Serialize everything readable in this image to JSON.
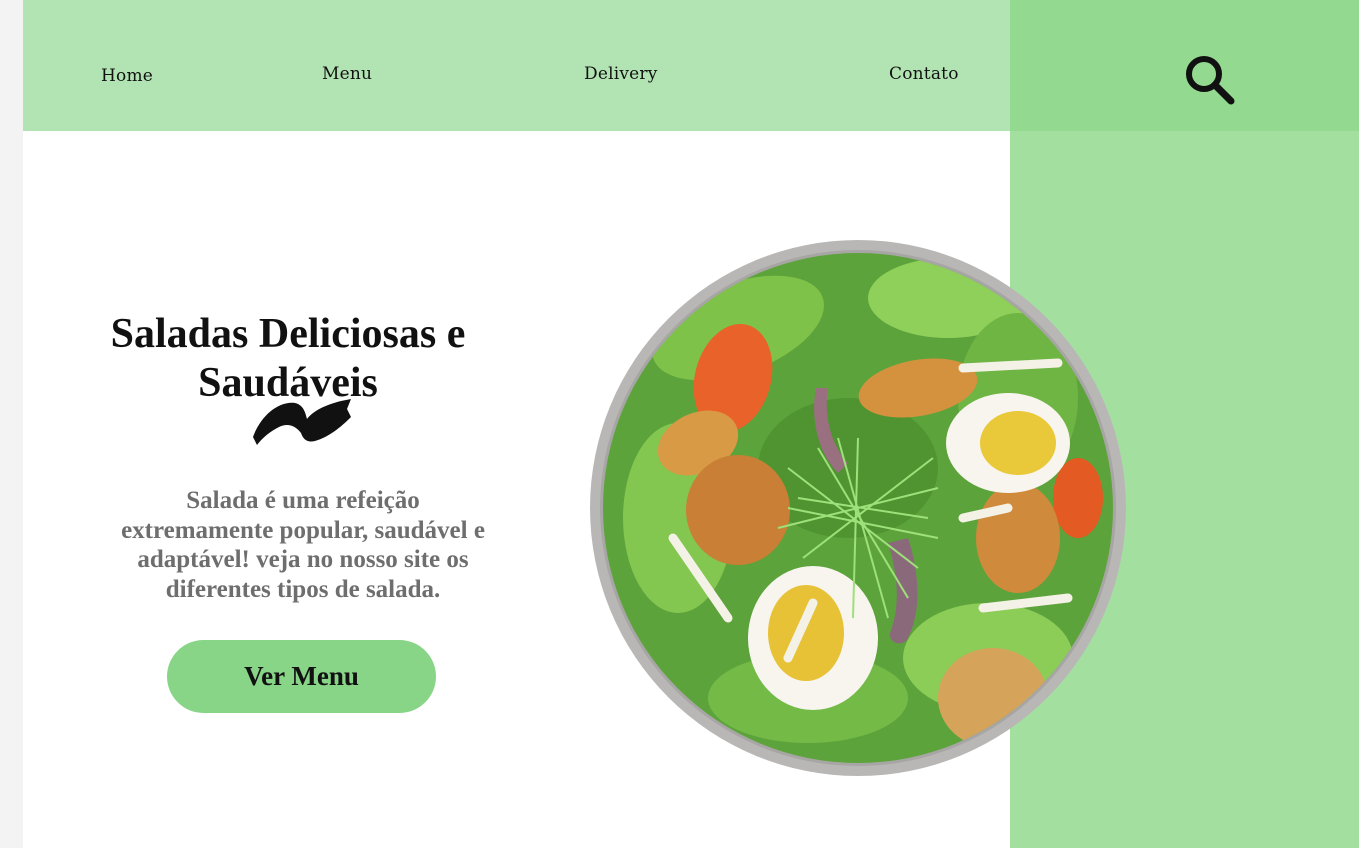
{
  "nav": {
    "items": [
      {
        "label": "Home"
      },
      {
        "label": "Menu"
      },
      {
        "label": "Delivery"
      },
      {
        "label": "Contato"
      }
    ],
    "search_icon": "search-icon"
  },
  "hero": {
    "title": "Saladas Deliciosas e Saudáveis",
    "ornament_icon": "ribbon-icon",
    "description": "Salada é uma refeição extremamente popular, saudável e adaptável! veja no nosso site os diferentes tipos de salada.",
    "button_label": "Ver Menu"
  },
  "image": {
    "subject": "salad-bowl"
  },
  "colors": {
    "nav_bg": "#b2e4b3",
    "search_bg": "#93d98f",
    "side_panel": "#a3e0a0",
    "button_bg": "#88d587",
    "description_text": "#6e6e6e"
  }
}
